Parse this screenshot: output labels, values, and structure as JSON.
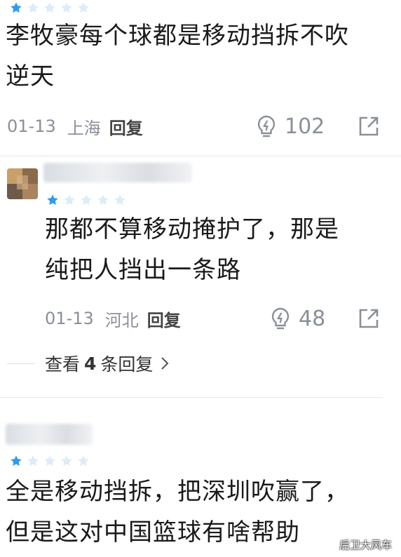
{
  "comments": [
    {
      "rating": 1,
      "text_lines": [
        "李牧豪每个球都是移动挡拆不吹",
        "逆天"
      ],
      "date": "01-13",
      "location": "上海",
      "reply_label": "回复",
      "likes": "102"
    },
    {
      "rating": 1,
      "text_lines": [
        "那都不算移动掩护了，那是",
        "纯把人挡出一条路"
      ],
      "date": "01-13",
      "location": "河北",
      "reply_label": "回复",
      "likes": "48",
      "view_replies": {
        "prefix": "查看",
        "count": "4",
        "suffix": "条回复"
      }
    },
    {
      "rating": 1,
      "text_lines": [
        "全是移动挡拆，把深圳吹赢了，",
        "但是这对中国篮球有啥帮助"
      ]
    }
  ],
  "watermark": "后卫大风车",
  "colors": {
    "star_active": "#2e9bf0",
    "star_inactive": "#dcecfb",
    "meta": "#8a8f99"
  }
}
